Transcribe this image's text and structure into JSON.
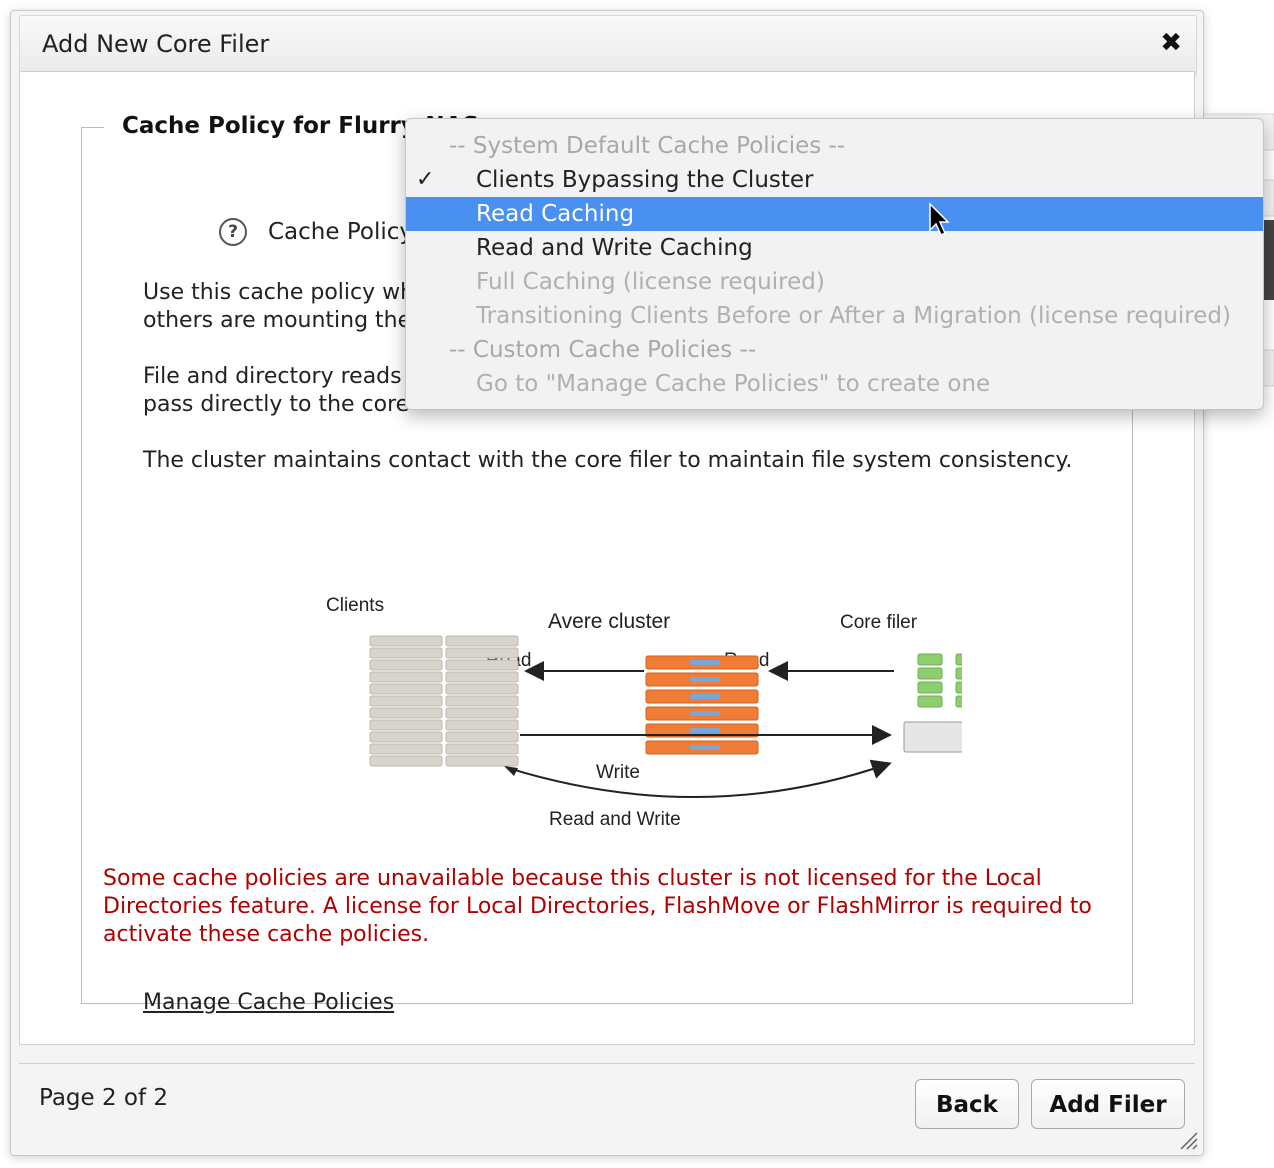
{
  "dialog": {
    "title": "Add New Core Filer",
    "close_icon": "close-icon"
  },
  "section": {
    "legend": "Cache Policy for Flurry-NAS",
    "field_label": "Cache Policy",
    "help_icon": "question-circle-icon"
  },
  "description": {
    "p1_line1": "Use this cache policy wh",
    "p1_line2": "others are mounting the",
    "p2_line1": "File and directory reads",
    "p2_line2": "pass directly to the core",
    "p3_line1": "The cluster maintains contact with the core filer to maintain file system consistency."
  },
  "diagram": {
    "clients_label": "Clients",
    "cluster_label": "Avere cluster",
    "core_filer_label": "Core filer",
    "read_left": "Read",
    "read_right": "Read",
    "write_label": "Write",
    "read_write_label": "Read and Write",
    "colors": {
      "cluster": "#f07c35",
      "core": "#8ccf6c",
      "clients": "#d8d4cc"
    }
  },
  "warning": {
    "text": "Some cache policies are unavailable because this cluster is not licensed for the Local Directories feature. A license for Local Directories, FlashMove or FlashMirror is required to activate these cache policies.",
    "color": "#b00000"
  },
  "manage_link": "Manage Cache Policies",
  "footer": {
    "page_indicator": "Page 2 of 2",
    "back_label": "Back",
    "add_label": "Add Filer"
  },
  "dropdown": {
    "group_system": "-- System Default Cache Policies --",
    "options": [
      {
        "label": "Clients Bypassing the Cluster",
        "state": "checked"
      },
      {
        "label": "Read Caching",
        "state": "highlighted"
      },
      {
        "label": "Read and Write Caching",
        "state": "enabled"
      },
      {
        "label": "Full Caching (license required)",
        "state": "disabled"
      },
      {
        "label": "Transitioning Clients Before or After a Migration (license required)",
        "state": "disabled"
      }
    ],
    "group_custom": "-- Custom Cache Policies --",
    "custom_hint": "Go to \"Manage Cache Policies\" to create one",
    "highlight_color": "#4a90f0"
  }
}
